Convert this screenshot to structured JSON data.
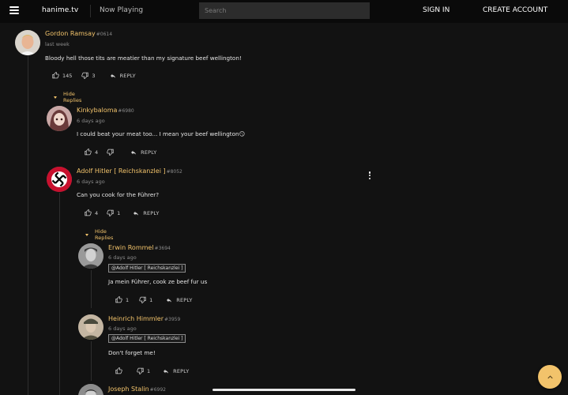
{
  "header": {
    "brand": "hanime.tv",
    "now_playing": "Now Playing",
    "search_placeholder": "Search",
    "sign_in": "SIGN IN",
    "create_account": "CREATE ACCOUNT"
  },
  "comments": [
    {
      "username": "Gordon Ramsay",
      "tag": "#0614",
      "time": "last week",
      "body": "Bloody hell those tits are meatier than my signature beef wellington!",
      "likes": "145",
      "dislikes": "3",
      "reply": "REPLY",
      "hide_replies": "Hide Replies"
    },
    {
      "username": "Kinkybaloma",
      "tag": "#6980",
      "time": "6 days ago",
      "body": "I could beat your meat too... I mean your beef wellington😏",
      "likes": "4",
      "dislikes": "",
      "reply": "REPLY"
    },
    {
      "username": "Adolf Hitler [ Reichskanzlei ]",
      "tag": "#8052",
      "time": "6 days ago",
      "body": "Can you cook for the Führer?",
      "likes": "4",
      "dislikes": "1",
      "reply": "REPLY",
      "hide_replies": "Hide Replies"
    },
    {
      "username": "Erwin Rommel",
      "tag": "#3694",
      "time": "6 days ago",
      "mention": "@Adolf Hitler [ Reichskanzlei ]",
      "body": "Ja mein Führer, cook ze beef fur us",
      "likes": "1",
      "dislikes": "1",
      "reply": "REPLY"
    },
    {
      "username": "Heinrich Himmler",
      "tag": "#3959",
      "time": "6 days ago",
      "mention": "@Adolf Hitler [ Reichskanzlei ]",
      "body": "Don't forget me!",
      "likes": "",
      "dislikes": "1",
      "reply": "REPLY"
    },
    {
      "username": "Joseph Stalin",
      "tag": "#6992"
    }
  ],
  "icons": {
    "like": "thumbs-up-icon",
    "dislike": "thumbs-down-icon",
    "reply": "reply-arrow-icon",
    "scroll_top": "chevron-up-icon"
  },
  "colors": {
    "accent": "#f2c36b",
    "background": "#121212"
  }
}
